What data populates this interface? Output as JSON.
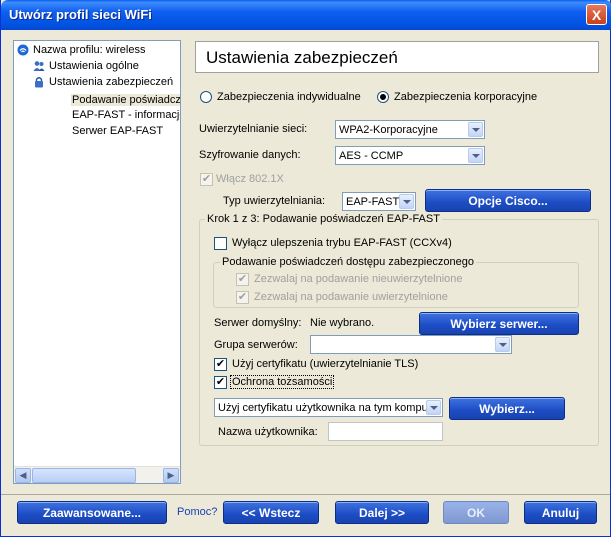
{
  "window": {
    "title": "Utwórz profil sieci WiFi",
    "close_glyph": "X"
  },
  "tree": {
    "items": [
      {
        "label": "Nazwa profilu: wireless",
        "icon": "wifi-icon"
      },
      {
        "label": "Ustawienia ogólne",
        "icon": "users-icon"
      },
      {
        "label": "Ustawienia zabezpieczeń",
        "icon": "lock-icon"
      },
      {
        "label": "Podawanie poświadcze"
      },
      {
        "label": "EAP-FAST - informacje"
      },
      {
        "label": "Serwer EAP-FAST"
      }
    ]
  },
  "header": {
    "title": "Ustawienia zabezpieczeń"
  },
  "security_mode": {
    "individual_label": "Zabezpieczenia indywidualne",
    "corporate_label": "Zabezpieczenia korporacyjne",
    "selected": "corporate"
  },
  "network_auth": {
    "label": "Uwierzytelnianie sieci:",
    "value": "WPA2-Korporacyjne"
  },
  "data_encryption": {
    "label": "Szyfrowanie danych:",
    "value": "AES - CCMP"
  },
  "enable_8021x": {
    "label": "Włącz 802.1X",
    "checked": true,
    "disabled": true
  },
  "auth_type": {
    "label": "Typ uwierzytelniania:",
    "value": "EAP-FAST"
  },
  "cisco_button": {
    "label": "Opcje Cisco..."
  },
  "step_group": {
    "legend": "Krok 1 z 3: Podawanie poświadczeń EAP-FAST",
    "disable_enhancements": "Wyłącz ulepszenia trybu EAP-FAST (CCXv4)",
    "provisioning_group": {
      "legend": "Podawanie poświadczeń dostępu zabezpieczonego",
      "allow_unauth": "Zezwalaj na podawanie nieuwierzytelnione",
      "allow_auth": "Zezwalaj na podawanie uwierzytelnione"
    },
    "default_server_label": "Serwer domyślny:",
    "default_server_value": "Nie wybrano.",
    "select_server_button": "Wybierz serwer...",
    "server_group_label": "Grupa serwerów:",
    "server_group_value": "",
    "use_cert_label": "Użyj certyfikatu (uwierzytelnianie TLS)",
    "identity_protection_label": "Ochrona tożsamości",
    "cert_select_value": "Użyj certyfikatu użytkownika na tym komput",
    "select_button": "Wybierz...",
    "username_label": "Nazwa użytkownika:",
    "username_value": ""
  },
  "footer": {
    "advanced_button": "Zaawansowane...",
    "help_link": "Pomoc?",
    "back_button": "<< Wstecz",
    "next_button": "Dalej >>",
    "ok_button": "OK",
    "cancel_button": "Anuluj"
  },
  "colors": {
    "titlebar": "#0054e3",
    "button_blue": "#1c4cc4",
    "panel_bg": "#ece9d8"
  }
}
